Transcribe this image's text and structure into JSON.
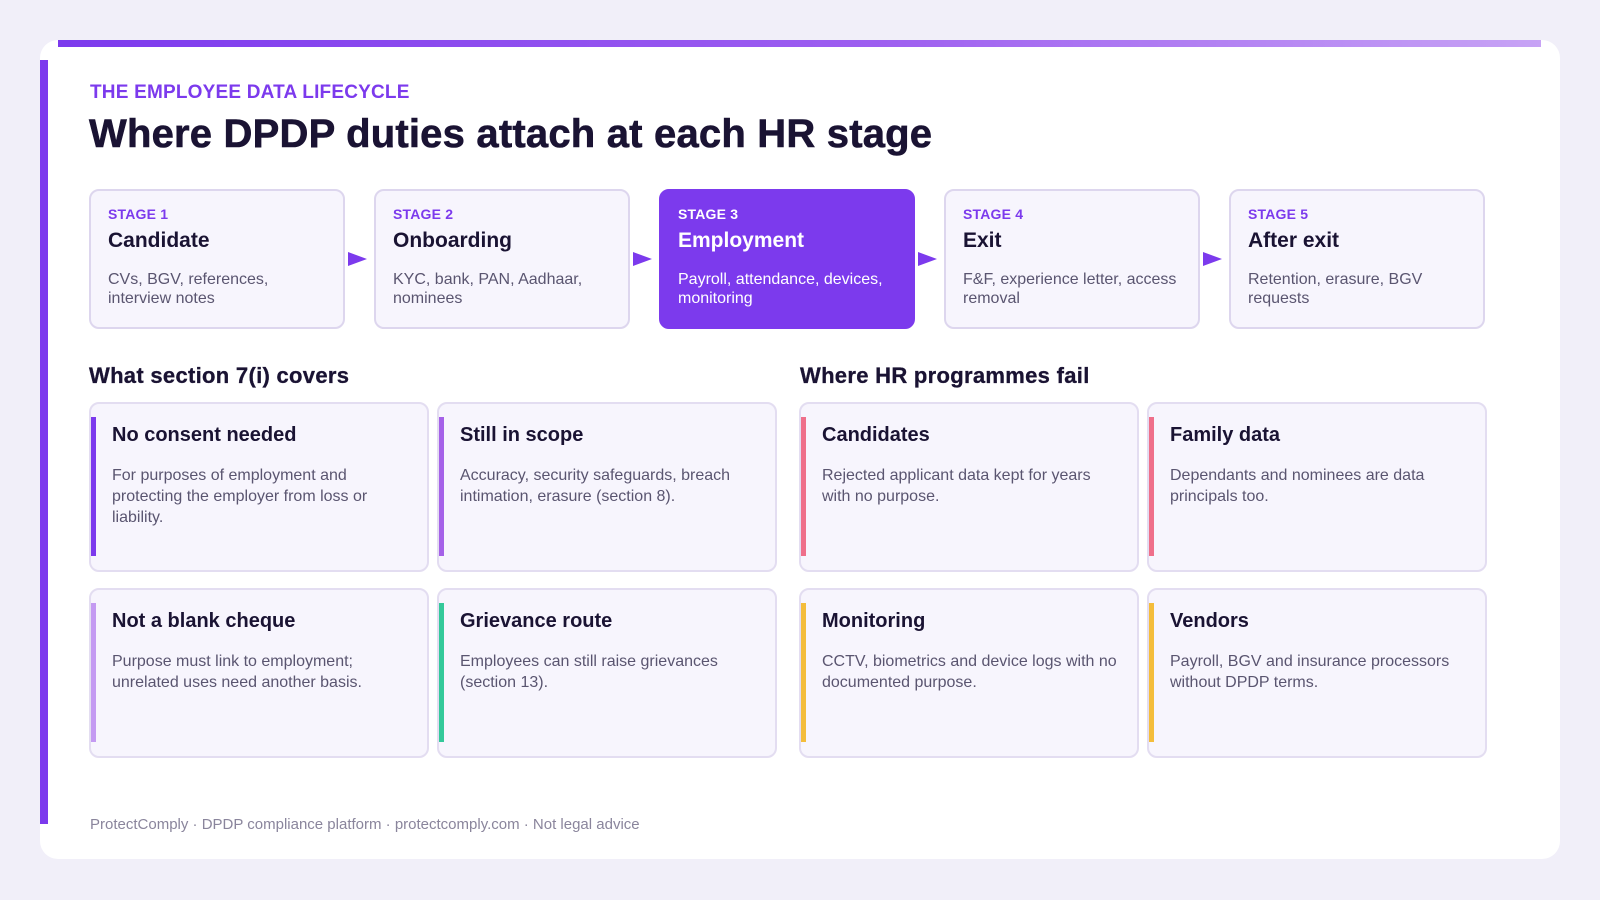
{
  "eyebrow": "THE EMPLOYEE DATA LIFECYCLE",
  "title": "Where DPDP duties attach at each HR stage",
  "stages": [
    {
      "num": "STAGE 1",
      "name": "Candidate",
      "desc": "CVs, BGV, references, interview notes",
      "active": false
    },
    {
      "num": "STAGE 2",
      "name": "Onboarding",
      "desc": "KYC, bank, PAN, Aadhaar, nominees",
      "active": false
    },
    {
      "num": "STAGE 3",
      "name": "Employment",
      "desc": "Payroll, attendance, devices, monitoring",
      "active": true
    },
    {
      "num": "STAGE 4",
      "name": "Exit",
      "desc": "F&F, experience letter, access removal",
      "active": false
    },
    {
      "num": "STAGE 5",
      "name": "After exit",
      "desc": "Retention, erasure, BGV requests",
      "active": false
    }
  ],
  "covers": {
    "heading": "What section 7(i) covers",
    "items": [
      {
        "title": "No consent needed",
        "desc": "For purposes of employment and protecting the employer from loss or liability.",
        "accent": "#7c3aed"
      },
      {
        "title": "Still in scope",
        "desc": "Accuracy, security safeguards, breach intimation, erasure (section 8).",
        "accent": "#a561e8"
      },
      {
        "title": "Not a blank cheque",
        "desc": "Purpose must link to employment; unrelated uses need another basis.",
        "accent": "#c49af2"
      },
      {
        "title": "Grievance route",
        "desc": "Employees can still raise grievances (section 13).",
        "accent": "#34c99a"
      }
    ]
  },
  "fails": {
    "heading": "Where HR programmes fail",
    "items": [
      {
        "title": "Candidates",
        "desc": "Rejected applicant data kept for years with no purpose.",
        "accent": "#ef6f8a"
      },
      {
        "title": "Family data",
        "desc": "Dependants and nominees are data principals too.",
        "accent": "#ef6f8a"
      },
      {
        "title": "Monitoring",
        "desc": "CCTV, biometrics and device logs with no documented purpose.",
        "accent": "#f4bd3b"
      },
      {
        "title": "Vendors",
        "desc": "Payroll, BGV and insurance processors without DPDP terms.",
        "accent": "#f4bd3b"
      }
    ]
  },
  "footer": "ProtectComply · DPDP compliance platform · protectcomply.com · Not legal advice"
}
